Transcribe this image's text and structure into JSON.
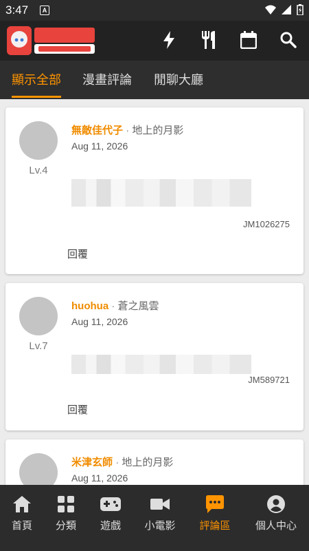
{
  "status_bar": {
    "time": "3:47",
    "badge": "A"
  },
  "header": {
    "logo_icon": "comic-logo",
    "actions": [
      "lightning-icon",
      "utensils-icon",
      "calendar-icon",
      "search-icon"
    ]
  },
  "tabs": [
    {
      "label": "顯示全部",
      "active": true
    },
    {
      "label": "漫畫評論",
      "active": false
    },
    {
      "label": "閒聊大廳",
      "active": false
    }
  ],
  "comments": [
    {
      "username": "無敵佳代子",
      "separator": "·",
      "title": "地上的月影",
      "date": "Aug 11, 2026",
      "level": "Lv.4",
      "content_id": "JM1026275",
      "reply_label": "回覆"
    },
    {
      "username": "huohua",
      "separator": "·",
      "title": "蒼之風雲",
      "date": "Aug 11, 2026",
      "level": "Lv.7",
      "content_id": "JM589721",
      "reply_label": "回覆"
    },
    {
      "username": "米津玄師",
      "separator": "·",
      "title": "地上的月影",
      "date": "Aug 11, 2026",
      "level": "",
      "content_id": "",
      "reply_label": ""
    }
  ],
  "bottom_nav": [
    {
      "label": "首頁",
      "icon": "home-icon",
      "active": false
    },
    {
      "label": "分類",
      "icon": "grid-icon",
      "active": false
    },
    {
      "label": "遊戲",
      "icon": "gamepad-icon",
      "active": false
    },
    {
      "label": "小電影",
      "icon": "video-icon",
      "active": false
    },
    {
      "label": "評論區",
      "icon": "comment-icon",
      "active": true
    },
    {
      "label": "個人中心",
      "icon": "profile-icon",
      "active": false
    }
  ],
  "colors": {
    "accent": "#ff9400",
    "appbar": "#222222",
    "tabbar": "#2e2e2e",
    "background": "#ececec"
  }
}
